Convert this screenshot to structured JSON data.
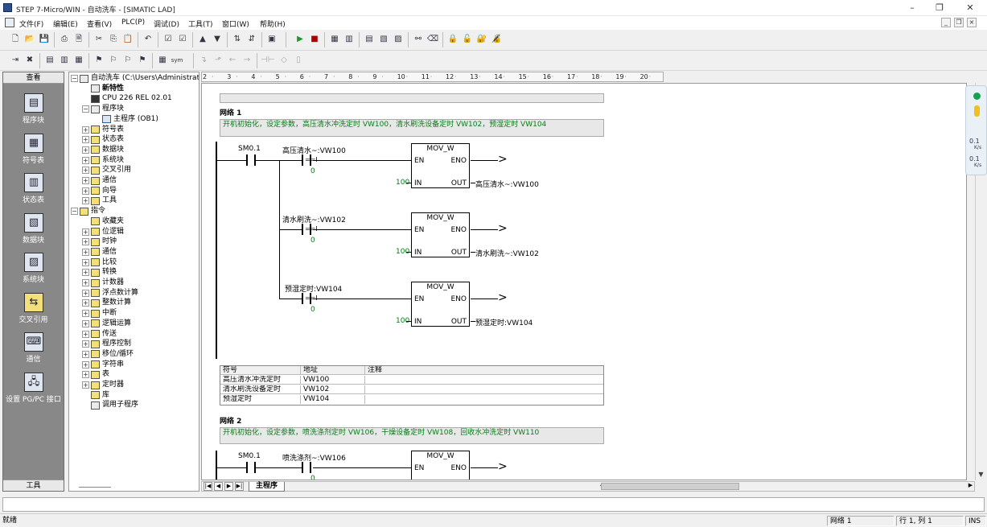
{
  "window": {
    "title": "STEP 7-Micro/WIN - 自动洗车 - [SIMATIC LAD]"
  },
  "menu": [
    "文件(F)",
    "编辑(E)",
    "查看(V)",
    "PLC(P)",
    "调试(D)",
    "工具(T)",
    "窗口(W)",
    "帮助(H)"
  ],
  "nav": {
    "header": "查看",
    "footer": "工具",
    "items": [
      {
        "label": "程序块",
        "icon": "program-block-icon"
      },
      {
        "label": "符号表",
        "icon": "symbol-table-icon"
      },
      {
        "label": "状态表",
        "icon": "status-table-icon"
      },
      {
        "label": "数据块",
        "icon": "data-block-icon"
      },
      {
        "label": "系统块",
        "icon": "system-block-icon"
      },
      {
        "label": "交叉引用",
        "icon": "cross-reference-icon"
      },
      {
        "label": "通信",
        "icon": "communication-icon"
      },
      {
        "label": "设置 PG/PC 接口",
        "icon": "pgpc-interface-icon"
      }
    ]
  },
  "tree": {
    "nodes": [
      {
        "label": "自动洗车 (C:\\Users\\Administrator",
        "level": 0,
        "exp": "−",
        "icon": "project-icon",
        "type": "doc"
      },
      {
        "label": "新特性",
        "level": 1,
        "exp": "",
        "icon": "whats-new-icon",
        "type": "doc",
        "bold": true
      },
      {
        "label": "CPU 226 REL 02.01",
        "level": 1,
        "exp": "",
        "icon": "cpu-icon",
        "type": "cpu"
      },
      {
        "label": "程序块",
        "level": 1,
        "exp": "−",
        "icon": "program-block-icon",
        "type": "doc"
      },
      {
        "label": "主程序 (OB1)",
        "level": 2,
        "exp": "",
        "icon": "ob1-icon",
        "type": "ob"
      },
      {
        "label": "符号表",
        "level": 1,
        "exp": "+",
        "icon": "symbol-table-icon",
        "type": "folder"
      },
      {
        "label": "状态表",
        "level": 1,
        "exp": "+",
        "icon": "status-table-icon",
        "type": "folder"
      },
      {
        "label": "数据块",
        "level": 1,
        "exp": "+",
        "icon": "data-block-icon",
        "type": "folder"
      },
      {
        "label": "系统块",
        "level": 1,
        "exp": "+",
        "icon": "system-block-icon",
        "type": "folder"
      },
      {
        "label": "交叉引用",
        "level": 1,
        "exp": "+",
        "icon": "cross-reference-icon",
        "type": "folder"
      },
      {
        "label": "通信",
        "level": 1,
        "exp": "+",
        "icon": "communication-icon",
        "type": "folder"
      },
      {
        "label": "向导",
        "level": 1,
        "exp": "+",
        "icon": "wizard-icon",
        "type": "folder"
      },
      {
        "label": "工具",
        "level": 1,
        "exp": "+",
        "icon": "tools-icon",
        "type": "folder"
      },
      {
        "label": "指令",
        "level": 0,
        "exp": "−",
        "icon": "instructions-icon",
        "type": "folder"
      },
      {
        "label": "收藏夹",
        "level": 1,
        "exp": "",
        "icon": "favorites-icon",
        "type": "folder"
      },
      {
        "label": "位逻辑",
        "level": 1,
        "exp": "+",
        "icon": "bit-logic-icon",
        "type": "folder"
      },
      {
        "label": "时钟",
        "level": 1,
        "exp": "+",
        "icon": "clock-icon",
        "type": "folder"
      },
      {
        "label": "通信",
        "level": 1,
        "exp": "+",
        "icon": "communication-icon",
        "type": "folder"
      },
      {
        "label": "比较",
        "level": 1,
        "exp": "+",
        "icon": "compare-icon",
        "type": "folder"
      },
      {
        "label": "转换",
        "level": 1,
        "exp": "+",
        "icon": "convert-icon",
        "type": "folder"
      },
      {
        "label": "计数器",
        "level": 1,
        "exp": "+",
        "icon": "counter-icon",
        "type": "folder"
      },
      {
        "label": "浮点数计算",
        "level": 1,
        "exp": "+",
        "icon": "float-math-icon",
        "type": "folder"
      },
      {
        "label": "整数计算",
        "level": 1,
        "exp": "+",
        "icon": "integer-math-icon",
        "type": "folder"
      },
      {
        "label": "中断",
        "level": 1,
        "exp": "+",
        "icon": "interrupt-icon",
        "type": "folder"
      },
      {
        "label": "逻辑运算",
        "level": 1,
        "exp": "+",
        "icon": "logic-ops-icon",
        "type": "folder"
      },
      {
        "label": "传送",
        "level": 1,
        "exp": "+",
        "icon": "move-icon",
        "type": "folder"
      },
      {
        "label": "程序控制",
        "level": 1,
        "exp": "+",
        "icon": "program-control-icon",
        "type": "folder"
      },
      {
        "label": "移位/循环",
        "level": 1,
        "exp": "+",
        "icon": "shift-rotate-icon",
        "type": "folder"
      },
      {
        "label": "字符串",
        "level": 1,
        "exp": "+",
        "icon": "string-icon",
        "type": "folder"
      },
      {
        "label": "表",
        "level": 1,
        "exp": "+",
        "icon": "table-icon",
        "type": "folder"
      },
      {
        "label": "定时器",
        "level": 1,
        "exp": "+",
        "icon": "timer-icon",
        "type": "folder"
      },
      {
        "label": "库",
        "level": 1,
        "exp": "",
        "icon": "library-icon",
        "type": "folder"
      },
      {
        "label": "调用子程序",
        "level": 1,
        "exp": "",
        "icon": "call-subroutine-icon",
        "type": "doc"
      }
    ]
  },
  "ruler": [
    "2",
    "3",
    "4",
    "5",
    "6",
    "7",
    "8",
    "9",
    "10",
    "11",
    "12",
    "13",
    "14",
    "15",
    "16",
    "17",
    "18",
    "19",
    "20"
  ],
  "network1": {
    "title": "网络 1",
    "comment": "开机初始化，设定参数，高压清水冲洗定时    VW100，清水刷洗设备定时              VW102，预湿定时 VW104",
    "contact_sm": "SM0.1",
    "rungs": [
      {
        "cmp_label": "高压清水~:VW100",
        "cmp_op": "==I",
        "cmp_val": "0",
        "block": "MOV_W",
        "en": "EN",
        "eno": "ENO",
        "in_pin": "IN",
        "out_pin": "OUT",
        "in_val": "100",
        "out_val": "高压清水~:VW100"
      },
      {
        "cmp_label": "清水刷洗~:VW102",
        "cmp_op": "==I",
        "cmp_val": "0",
        "block": "MOV_W",
        "en": "EN",
        "eno": "ENO",
        "in_pin": "IN",
        "out_pin": "OUT",
        "in_val": "100",
        "out_val": "清水刷洗~:VW102"
      },
      {
        "cmp_label": "预湿定时:VW104",
        "cmp_op": "==I",
        "cmp_val": "0",
        "block": "MOV_W",
        "en": "EN",
        "eno": "ENO",
        "in_pin": "IN",
        "out_pin": "OUT",
        "in_val": "100",
        "out_val": "预湿定时:VW104"
      }
    ],
    "symtable": {
      "headers": [
        "符号",
        "地址",
        "注释"
      ],
      "rows": [
        [
          "高压清水冲洗定时",
          "VW100",
          ""
        ],
        [
          "清水刷洗设备定时",
          "VW102",
          ""
        ],
        [
          "预湿定时",
          "VW104",
          ""
        ]
      ]
    }
  },
  "network2": {
    "title": "网络 2",
    "comment": "开机初始化，设定参数，喷洗涤剂定时        VW106，干燥设备定时        VW108，回收水冲洗定时    VW110",
    "contact_sm": "SM0.1",
    "cmp_label": "喷洗涤剂~:VW106",
    "block": "MOV_W",
    "en": "EN",
    "eno": "ENO",
    "cmp_val": "0"
  },
  "editor_tab": "主程序",
  "sidepanel": {
    "v1": "0.1",
    "v2": "0.1",
    "u1": "K/s",
    "u2": "K/s"
  },
  "status": {
    "left": "就绪",
    "network": "网络 1",
    "position": "行 1, 列 1",
    "mode": "INS"
  },
  "colors": {
    "comment_text": "#0a7a1a",
    "nav_bg": "#888888"
  }
}
